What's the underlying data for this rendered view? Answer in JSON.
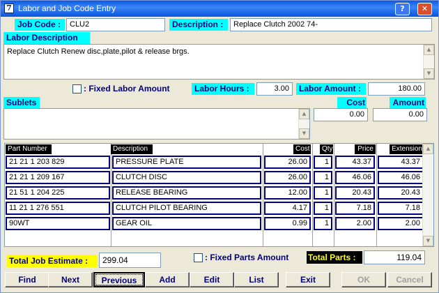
{
  "window": {
    "title": "Labor and Job Code Entry",
    "icon": "7",
    "help_glyph": "?",
    "close_glyph": "✕"
  },
  "header": {
    "job_code_label": "Job Code :",
    "job_code_value": "CLU2",
    "description_label": "Description :",
    "description_value": "Replace Clutch 2002 74-"
  },
  "labor": {
    "section_label": "Labor Description",
    "text": "Replace Clutch Renew disc,plate,pilot & release brgs.",
    "fixed_label": ": Fixed Labor Amount",
    "hours_label": "Labor Hours :",
    "hours_value": "3.00",
    "amount_label": "Labor Amount :",
    "amount_value": "180.00"
  },
  "sublets": {
    "section_label": "Sublets",
    "cost_label": "Cost",
    "cost_value": "0.00",
    "amount_label": "Amount",
    "amount_value": "0.00"
  },
  "parts": {
    "headers": [
      "Part Number",
      "Description",
      "Cost",
      "Qty",
      "Price",
      "Extension"
    ],
    "rows": [
      [
        "21 21 1 203 829",
        "PRESSURE PLATE",
        "26.00",
        "1",
        "43.37",
        "43.37"
      ],
      [
        "21 21 1 209 167",
        "CLUTCH DISC",
        "26.00",
        "1",
        "46.06",
        "46.06"
      ],
      [
        "21 51 1 204 225",
        "RELEASE BEARING",
        "12.00",
        "1",
        "20.43",
        "20.43"
      ],
      [
        "11 21 1 276 551",
        "CLUTCH PILOT BEARING",
        "4.17",
        "1",
        "7.18",
        "7.18"
      ],
      [
        "90WT",
        "GEAR OIL",
        "0.99",
        "1",
        "2.00",
        "2.00"
      ]
    ]
  },
  "footer": {
    "total_job_label": "Total Job Estimate :",
    "total_job_value": "299.04",
    "fixed_parts_label": ": Fixed Parts Amount",
    "total_parts_label": "Total Parts :",
    "total_parts_value": "119.04"
  },
  "buttons": {
    "find": "Find",
    "next": "Next",
    "previous": "Previous",
    "add": "Add",
    "edit": "Edit",
    "list": "List",
    "exit": "Exit",
    "ok": "OK",
    "cancel": "Cancel"
  },
  "colors": {
    "label_bg": "#00ffff",
    "label_text": "#000080",
    "total_bg": "#ffff00",
    "title_bar": "#0a5ae0"
  }
}
